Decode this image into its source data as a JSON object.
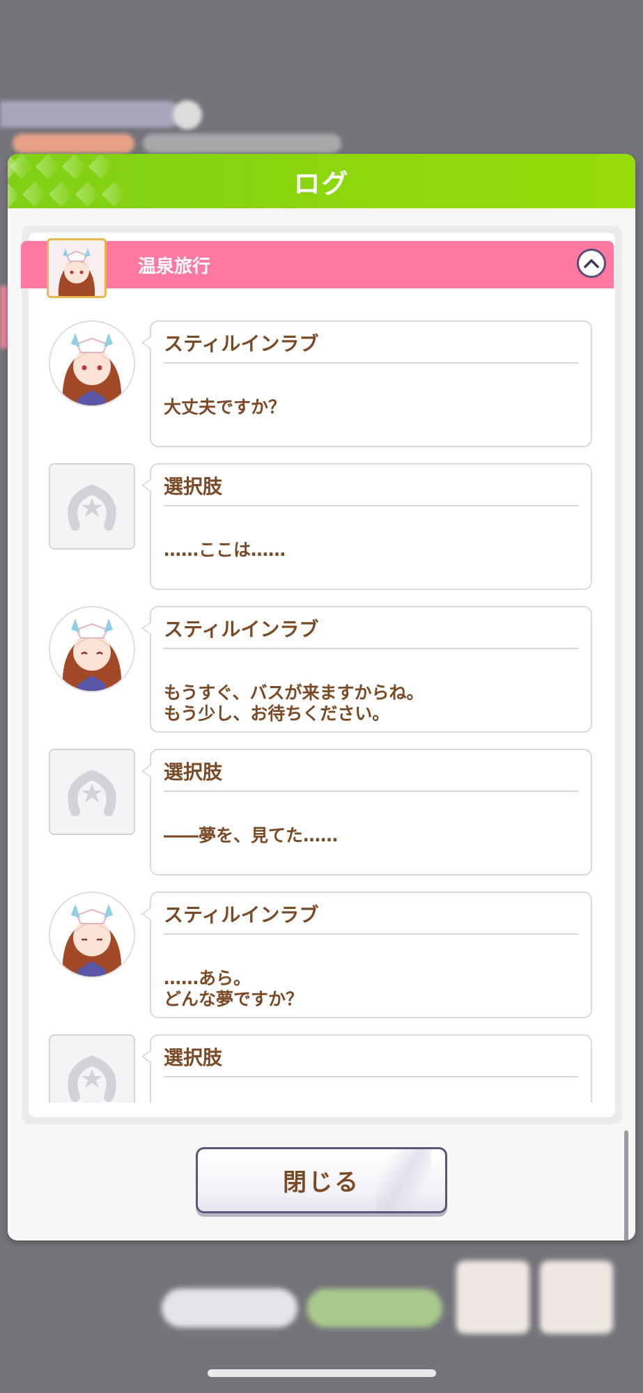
{
  "dialog": {
    "title": "ログ",
    "close_label": "閉じる"
  },
  "chapter": {
    "title": "温泉旅行",
    "collapse_icon": "chevron-up-icon"
  },
  "entries": [
    {
      "type": "character",
      "speaker": "スティルインラブ",
      "text": "大丈夫ですか？"
    },
    {
      "type": "choice",
      "speaker": "選択肢",
      "text": "……ここは……"
    },
    {
      "type": "character",
      "speaker": "スティルインラブ",
      "text": "もうすぐ、バスが来ますからね。\nもう少し、お待ちください。"
    },
    {
      "type": "choice",
      "speaker": "選択肢",
      "text": "――夢を、見てた……"
    },
    {
      "type": "character",
      "speaker": "スティルインラブ",
      "text": "……あら。\nどんな夢ですか？"
    },
    {
      "type": "choice",
      "speaker": "選択肢",
      "text": ""
    }
  ],
  "colors": {
    "header_green": "#8ed80c",
    "chapter_pink": "#ff78a0",
    "text_brown": "#7a4a26",
    "button_border": "#5c5578"
  }
}
